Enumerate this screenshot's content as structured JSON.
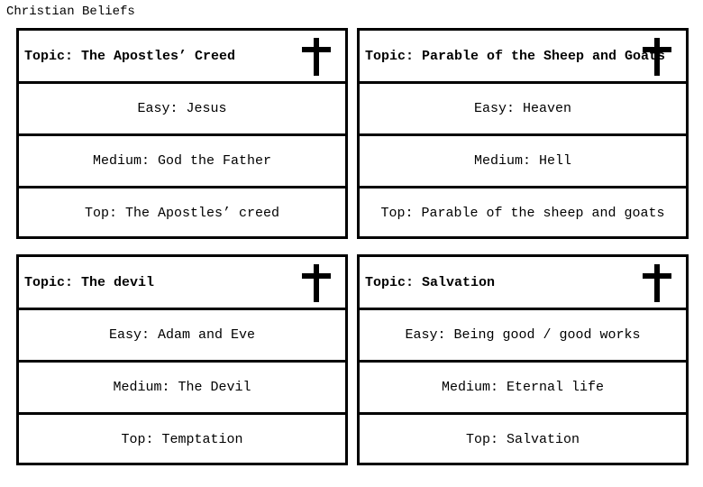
{
  "page": {
    "title": "Christian Beliefs"
  },
  "cards": [
    {
      "topic": "Topic: The Apostles’ Creed",
      "icon": "cross-icon",
      "easy": "Easy: Jesus",
      "medium": "Medium: God the Father",
      "top": "Top: The Apostles’ creed"
    },
    {
      "topic": "Topic: Parable of the Sheep and Goats",
      "icon": "cross-icon",
      "easy": "Easy: Heaven",
      "medium": "Medium: Hell",
      "top": "Top: Parable of the sheep and goats"
    },
    {
      "topic": "Topic: The devil",
      "icon": "cross-icon",
      "easy": "Easy: Adam and Eve",
      "medium": "Medium: The Devil",
      "top": "Top: Temptation"
    },
    {
      "topic": "Topic: Salvation",
      "icon": "cross-icon",
      "easy": "Easy: Being good / good works",
      "medium": "Medium: Eternal life",
      "top": "Top: Salvation"
    }
  ]
}
